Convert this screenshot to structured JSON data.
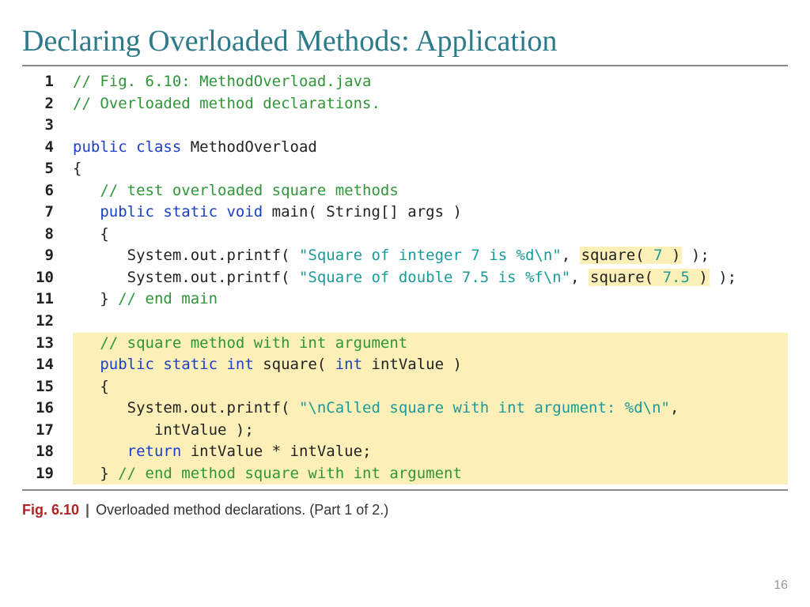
{
  "title": "Declaring Overloaded Methods: Application",
  "lines": {
    "1": {
      "a": "// Fig. 6.10: MethodOverload.java"
    },
    "2": {
      "a": "// Overloaded method declarations."
    },
    "4": {
      "kw1": "public class ",
      "name": "MethodOverload"
    },
    "5": {
      "brace": "{"
    },
    "6": {
      "a": "   // test overloaded square methods"
    },
    "7": {
      "kw1": "   public static void ",
      "name": "main( String[] args )"
    },
    "8": {
      "brace": "   {"
    },
    "9": {
      "a": "      System.out.printf( ",
      "s": "\"Square of integer 7 is %d\\n\"",
      "b": ", ",
      "call": "square( ",
      "n": "7",
      "call2": " )",
      "c": " );"
    },
    "10": {
      "a": "      System.out.printf( ",
      "s": "\"Square of double 7.5 is %f\\n\"",
      "b": ", ",
      "call": "square( ",
      "n": "7.5",
      "call2": " )",
      "c": " );"
    },
    "11": {
      "brace": "   } ",
      "cm": "// end main"
    },
    "13": {
      "a": "   // square method with int argument"
    },
    "14": {
      "kw1": "   public static int ",
      "name": "square( ",
      "kw2": "int ",
      "name2": "intValue )"
    },
    "15": {
      "brace": "   {"
    },
    "16": {
      "a": "      System.out.printf( ",
      "s": "\"\\nCalled square with int argument: %d\\n\"",
      "b": ","
    },
    "17": {
      "a": "         intValue );"
    },
    "18": {
      "kw": "      return ",
      "a": "intValue * intValue;"
    },
    "19": {
      "brace": "   } ",
      "cm": "// end method square with int argument"
    }
  },
  "caption": {
    "label": "Fig. 6.10",
    "text": "Overloaded method declarations. (Part 1 of 2.)"
  },
  "pagenum": "16"
}
